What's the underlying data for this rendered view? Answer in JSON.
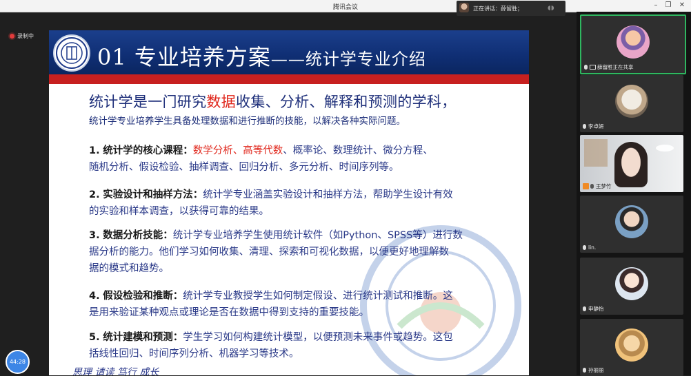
{
  "app": {
    "title": "腾讯会议"
  },
  "speaker": {
    "text": "正在讲话：薛留胜；"
  },
  "recording": {
    "label": "录制中"
  },
  "timer": {
    "text": "44:28"
  },
  "slide": {
    "title": "01 专业培养方案",
    "subtitle": "——统计学专业介绍",
    "headline_before": "统计学是一门研究",
    "headline_highlight": "数据",
    "headline_after": "收集、分析、解释和预测的学科，",
    "subline": "统计学专业培养学生具备处理数据和进行推断的技能，以解决各种实际问题。",
    "items": [
      {
        "num": "1.",
        "key": "统计学的核心课程：",
        "red": "数学分析、高等代数",
        "text": "、概率论、数理统计、微分方程、",
        "line2": "随机分析、假设检验、抽样调查、回归分析、多元分析、时间序列等。"
      },
      {
        "num": "2.",
        "key": "实验设计和抽样方法：",
        "text": "统计学专业涵盖实验设计和抽样方法，帮助学生设计有效",
        "line2": "的实验和样本调查，以获得可靠的结果。"
      },
      {
        "num": "3.",
        "key": "数据分析技能：",
        "text": "统计学专业培养学生使用统计软件（如Python、SPSS等）进行数",
        "line2": "据分析的能力。他们学习如何收集、清理、探索和可视化数据，以便更好地理解数",
        "line3": "据的模式和趋势。"
      },
      {
        "num": "4.",
        "key": "假设检验和推断：",
        "text": "统计学专业教授学生如何制定假设、进行统计测试和推断。这",
        "line2": "是用来验证某种观点或理论是否在数据中得到支持的重要技能。"
      },
      {
        "num": "5.",
        "key": "统计建模和预测：",
        "text": "学生学习如何构建统计模型，以便预测未来事件或趋势。这包",
        "line2": "括线性回归、时间序列分析、机器学习等技术。"
      }
    ],
    "bottom_script": "思理  请读  笃行  成长"
  },
  "participants": [
    {
      "label": "薛留胜正在共享",
      "active": true,
      "icon": "share-icon"
    },
    {
      "label": "李卓妍",
      "active": false,
      "icon": "mic-icon"
    },
    {
      "label": "王梦竹",
      "active": false,
      "icon": "person-icon"
    },
    {
      "label": "lin.",
      "active": false,
      "icon": "mic-icon"
    },
    {
      "label": "申静怡",
      "active": false,
      "icon": "mic-icon"
    },
    {
      "label": "孙丽丽",
      "active": false,
      "icon": "mic-icon"
    }
  ],
  "colors": {
    "accent_green": "#2fb760",
    "slide_blue": "#0f2e73",
    "slide_red": "#c7201f"
  }
}
